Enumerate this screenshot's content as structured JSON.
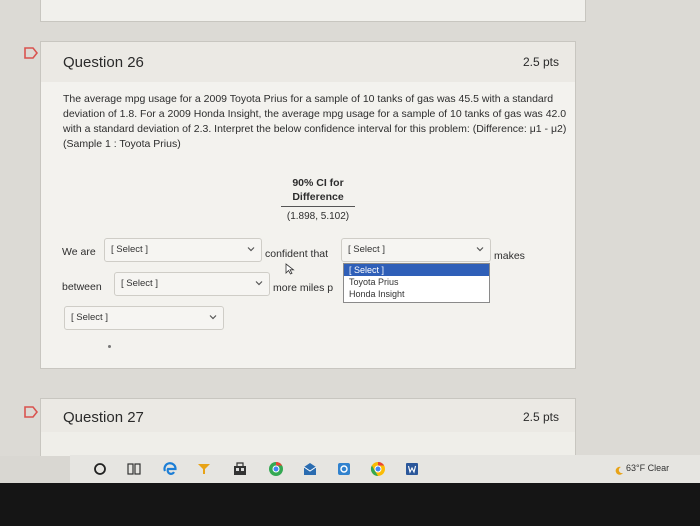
{
  "question26": {
    "title": "Question 26",
    "points": "2.5 pts",
    "text": "The average mpg usage for a 2009 Toyota Prius for a sample of 10 tanks of gas was 45.5 with a standard deviation of 1.8. For a 2009 Honda Insight, the average mpg usage for a sample of 10 tanks of gas was 42.0 with a standard deviation of 2.3. Interpret the below confidence interval for this problem: (Difference: μ1 - μ2) (Sample 1 : Toyota Prius)",
    "ci_header_line1": "90% CI for",
    "ci_header_line2": "Difference",
    "ci_value": "(1.898, 5.102)",
    "sentence": {
      "we_are": "We are",
      "confident_that": "confident that",
      "makes": "makes",
      "between": "between",
      "more_miles": "more miles p"
    },
    "selects": {
      "select1": "[ Select ]",
      "select2": "[ Select ]",
      "select3": "[ Select ]",
      "select4": "[ Select ]"
    },
    "dropdown_options": [
      "[ Select ]",
      "Toyota Prius",
      "Honda Insight"
    ]
  },
  "question27": {
    "title": "Question 27",
    "points": "2.5 pts"
  },
  "taskbar": {
    "weather": "63°F  Clear"
  },
  "colors": {
    "highlight": "#2f5fb8",
    "flag": "#d9534f"
  }
}
